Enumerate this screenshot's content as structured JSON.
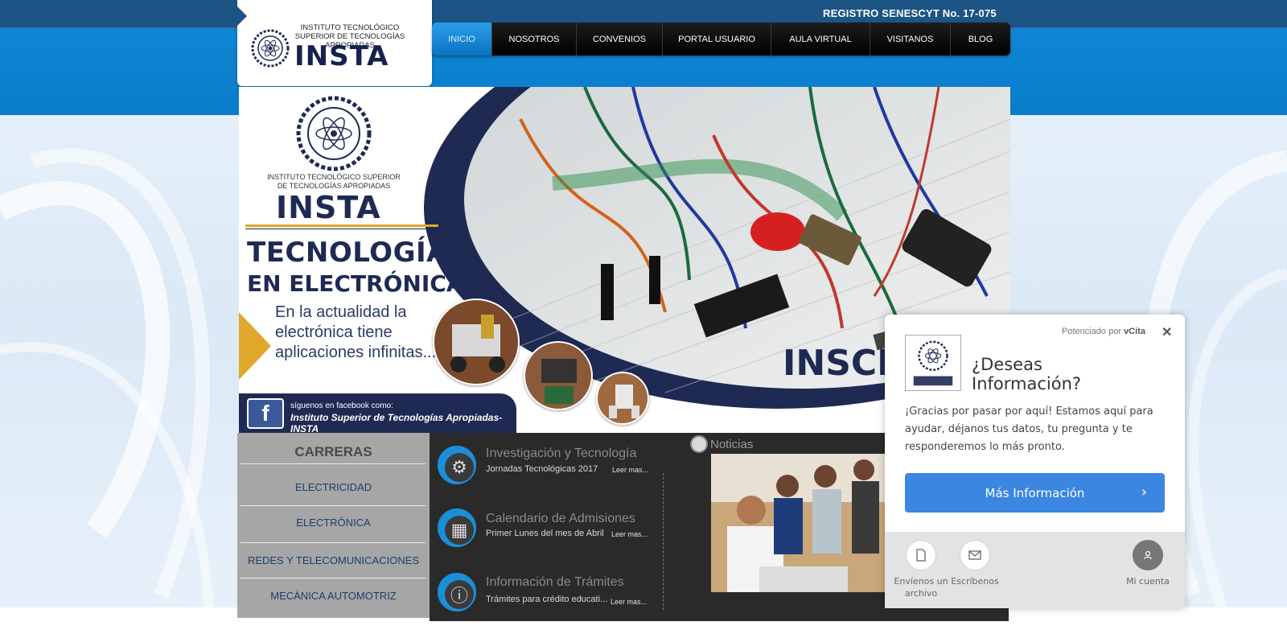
{
  "header": {
    "registro": "REGISTRO SENESCYT No. 17-075",
    "logo_subtitle": "INSTITUTO TECNOLÓGICO SUPERIOR DE TECNOLOGÍAS APROPIADAS",
    "logo_name": "INSTA"
  },
  "nav": {
    "items": [
      {
        "label": "INICIO",
        "active": true
      },
      {
        "label": "NOSOTROS",
        "active": false
      },
      {
        "label": "CONVENIOS",
        "active": false
      },
      {
        "label": "PORTAL USUARIO",
        "active": false
      },
      {
        "label": "AULA VIRTUAL",
        "active": false
      },
      {
        "label": "VISITANOS",
        "active": false
      },
      {
        "label": "BLOG",
        "active": false
      }
    ]
  },
  "hero": {
    "subtitle": "INSTITUTO TECNOLÓGICO SUPERIOR DE TECNOLOGÍAS APROPIADAS",
    "name": "INSTA",
    "title1": "TECNOLOGÍA",
    "title2": "EN ELECTRÓNICA",
    "text": "En la actualidad la electrónica tiene aplicaciones infinitas...",
    "fb_small": "síguenos en facebook como:",
    "fb_big": "Instituto Superior de Tecnologías Apropiadas-INSTA",
    "overlay": "INSCR"
  },
  "carreras": {
    "title": "CARRERAS",
    "items": [
      "ELECTRICIDAD",
      "ELECTRÓNICA",
      "REDES Y TELECOMUNICACIONES",
      "MECÁNICA AUTOMOTRIZ"
    ]
  },
  "news": {
    "items": [
      {
        "title": "Investigación y Tecnología",
        "subtitle": "Jornadas Tecnológicas 2017",
        "more": "Leer mas...",
        "icon": "gear-icon"
      },
      {
        "title": "Calendario de Admisiones",
        "subtitle": "Primer Lunes del mes de Abril",
        "more": "Leer mas...",
        "icon": "calendar-icon"
      },
      {
        "title": "Información de Trámites",
        "subtitle": "Trámites para crédito educati...",
        "more": "Leer mas...",
        "icon": "info-icon"
      }
    ],
    "noticias_label": "Noticias"
  },
  "vcita": {
    "powered_prefix": "Potenciado por",
    "powered_brand": "vCita",
    "title": "¿Deseas Información?",
    "text": "¡Gracias por pasar por aquí! Estamos aquí para ayudar, déjanos tus datos, tu pregunta y te responderemos lo más pronto.",
    "button": "Más Información",
    "footer": {
      "send_file": "Envíenos un archivo",
      "write": "Escríbenos",
      "account": "Mi cuenta"
    }
  }
}
